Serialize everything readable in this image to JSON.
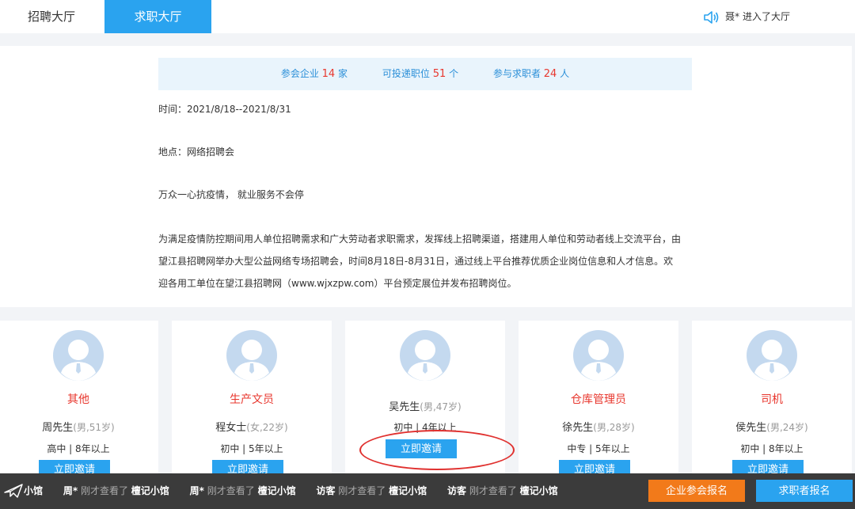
{
  "tabs": [
    "招聘大厅",
    "求职大厅"
  ],
  "notice": "聂* 进入了大厅",
  "stats": [
    {
      "label": "参会企业",
      "num": "14",
      "unit": "家"
    },
    {
      "label": "可投递职位",
      "num": "51",
      "unit": "个"
    },
    {
      "label": "参与求职者",
      "num": "24",
      "unit": "人"
    }
  ],
  "info": {
    "time": "时间：2021/8/18--2021/8/31",
    "place": "地点：网络招聘会",
    "slogan": "万众一心抗疫情， 就业服务不会停",
    "desc": "为满足疫情防控期间用人单位招聘需求和广大劳动者求职需求，发挥线上招聘渠道，搭建用人单位和劳动者线上交流平台，由望江县招聘网举办大型公益网络专场招聘会，时间8月18日-8月31日，通过线上平台推荐优质企业岗位信息和人才信息。欢迎各用工单位在望江县招聘网（www.wjxzpw.com）平台预定展位并发布招聘岗位。"
  },
  "cards": [
    {
      "job": "其他",
      "name": "周先生",
      "meta": "(男,51岁)",
      "edu": "高中 | 8年以上",
      "invite": "立即邀请"
    },
    {
      "job": "生产文员",
      "name": "程女士",
      "meta": "(女,22岁)",
      "edu": "初中 | 5年以上",
      "invite": "立即邀请"
    },
    {
      "job": "",
      "name": "吴先生",
      "meta": "(男,47岁)",
      "edu": "初中 | 4年以上",
      "invite": "立即邀请"
    },
    {
      "job": "仓库管理员",
      "name": "徐先生",
      "meta": "(男,28岁)",
      "edu": "中专 | 5年以上",
      "invite": "立即邀请"
    },
    {
      "job": "司机",
      "name": "侯先生",
      "meta": "(男,24岁)",
      "edu": "初中 | 8年以上",
      "invite": "立即邀请"
    }
  ],
  "ticker": [
    {
      "who": "",
      "act": "",
      "place": "小馆"
    },
    {
      "who": "周*",
      "act": "刚才查看了",
      "place": "檀记小馆"
    },
    {
      "who": "周*",
      "act": "刚才查看了",
      "place": "檀记小馆"
    },
    {
      "who": "访客",
      "act": "刚才查看了",
      "place": "檀记小馆"
    },
    {
      "who": "访客",
      "act": "刚才查看了",
      "place": "檀记小馆"
    }
  ],
  "buttons": {
    "enterprise": "企业参会报名",
    "seeker": "求职者报名"
  },
  "colors": {
    "accent": "#2aa3ef",
    "highlight": "#e8372e",
    "orange": "#f27a1a",
    "bar": "#3b3b3b"
  }
}
